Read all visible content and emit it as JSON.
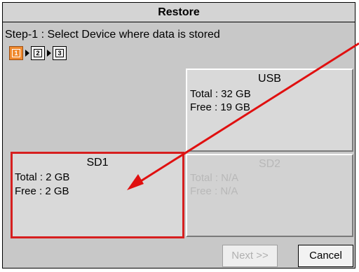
{
  "dialog": {
    "title": "Restore",
    "step_text": "Step-1 : Select Device where data is stored",
    "steps": [
      "1",
      "2",
      "3"
    ],
    "active_step": "1"
  },
  "devices": {
    "usb": {
      "name": "USB",
      "total": "Total : 32 GB",
      "free": "Free  : 19 GB",
      "enabled": true
    },
    "sd1": {
      "name": "SD1",
      "total": "Total : 2 GB",
      "free": "Free  : 2 GB",
      "enabled": true,
      "selected": true
    },
    "sd2": {
      "name": "SD2",
      "total": "Total : N/A",
      "free": "Free  : N/A",
      "enabled": false
    }
  },
  "buttons": {
    "next_label": "Next >>",
    "cancel_label": "Cancel"
  },
  "annotation_color": "#e01010",
  "selection_color": "#d61f1f",
  "active_step_color": "#f08a2e"
}
